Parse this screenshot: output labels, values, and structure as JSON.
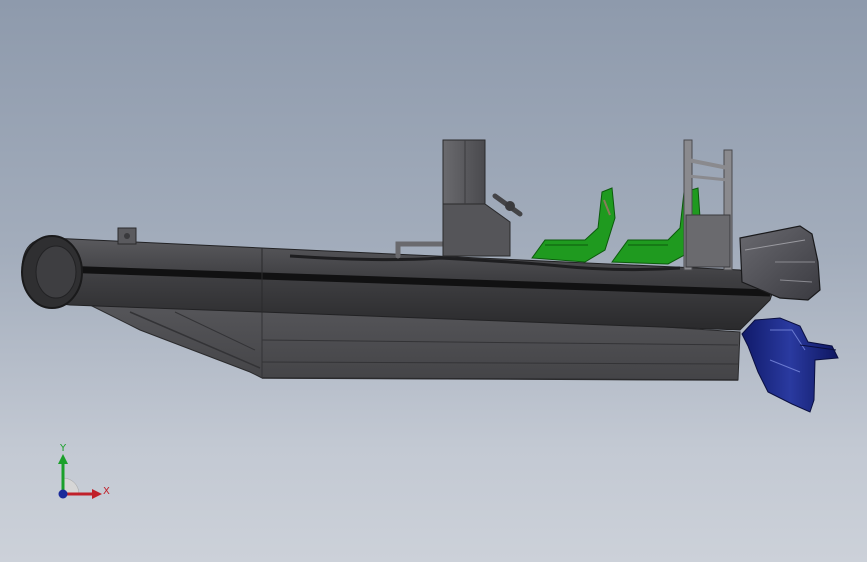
{
  "viewport": {
    "background_top": "#8e9aac",
    "background_bottom": "#ccd1d9"
  },
  "model": {
    "name": "boat-assembly",
    "parts": [
      "hull",
      "inflatable-tube",
      "console",
      "seats",
      "outboard-motor",
      "roll-bar"
    ],
    "colors": {
      "hull": "#4b4b4e",
      "tube": "#3b3b3d",
      "seats": "#1f9a1f",
      "motor_cover": "#505055",
      "motor_leg": "#1a2a8a"
    }
  },
  "triad": {
    "y_label": "Y",
    "x_label": "X",
    "colors": {
      "x": "#c0202a",
      "y": "#1aa02a",
      "z": "#1a2a9a"
    }
  }
}
